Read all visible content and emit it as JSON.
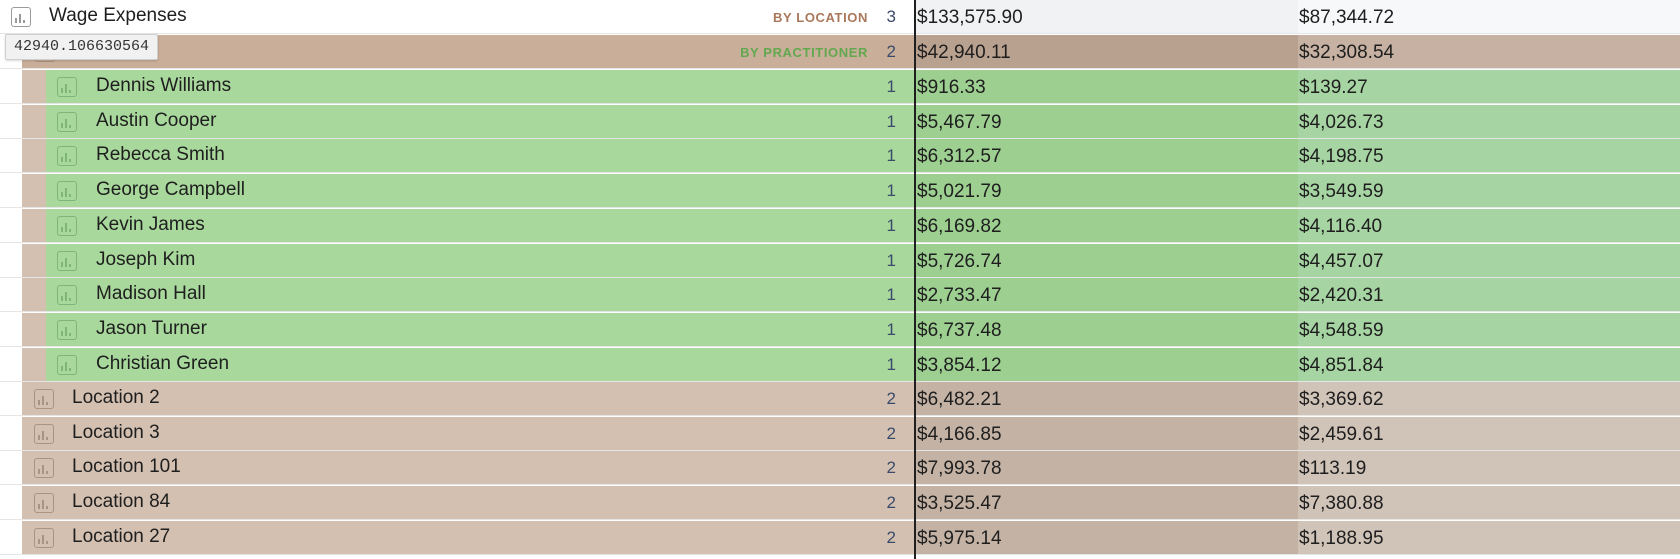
{
  "root": {
    "name": "Wage Expenses",
    "group_tag": "BY LOCATION",
    "count": "3",
    "value1": "$133,575.90",
    "value2": "$87,344.72"
  },
  "active_location": {
    "group_tag": "BY PRACTITIONER",
    "count": "2",
    "value1": "$42,940.11",
    "value2": "$32,308.54"
  },
  "tooltip": "42940.106630564",
  "practitioners": [
    {
      "name": "Dennis Williams",
      "count": "1",
      "value1": "$916.33",
      "value2": "$139.27"
    },
    {
      "name": "Austin Cooper",
      "count": "1",
      "value1": "$5,467.79",
      "value2": "$4,026.73"
    },
    {
      "name": "Rebecca Smith",
      "count": "1",
      "value1": "$6,312.57",
      "value2": "$4,198.75"
    },
    {
      "name": "George Campbell",
      "count": "1",
      "value1": "$5,021.79",
      "value2": "$3,549.59"
    },
    {
      "name": "Kevin James",
      "count": "1",
      "value1": "$6,169.82",
      "value2": "$4,116.40"
    },
    {
      "name": "Joseph Kim",
      "count": "1",
      "value1": "$5,726.74",
      "value2": "$4,457.07"
    },
    {
      "name": "Madison Hall",
      "count": "1",
      "value1": "$2,733.47",
      "value2": "$2,420.31"
    },
    {
      "name": "Jason Turner",
      "count": "1",
      "value1": "$6,737.48",
      "value2": "$4,548.59"
    },
    {
      "name": "Christian Green",
      "count": "1",
      "value1": "$3,854.12",
      "value2": "$4,851.84"
    }
  ],
  "locations": [
    {
      "name": "Location 2",
      "count": "2",
      "value1": "$6,482.21",
      "value2": "$3,369.62"
    },
    {
      "name": "Location 3",
      "count": "2",
      "value1": "$4,166.85",
      "value2": "$2,459.61"
    },
    {
      "name": "Location 101",
      "count": "2",
      "value1": "$7,993.78",
      "value2": "$113.19"
    },
    {
      "name": "Location 84",
      "count": "2",
      "value1": "$3,525.47",
      "value2": "$7,380.88"
    },
    {
      "name": "Location 27",
      "count": "2",
      "value1": "$5,975.14",
      "value2": "$1,188.95"
    }
  ]
}
